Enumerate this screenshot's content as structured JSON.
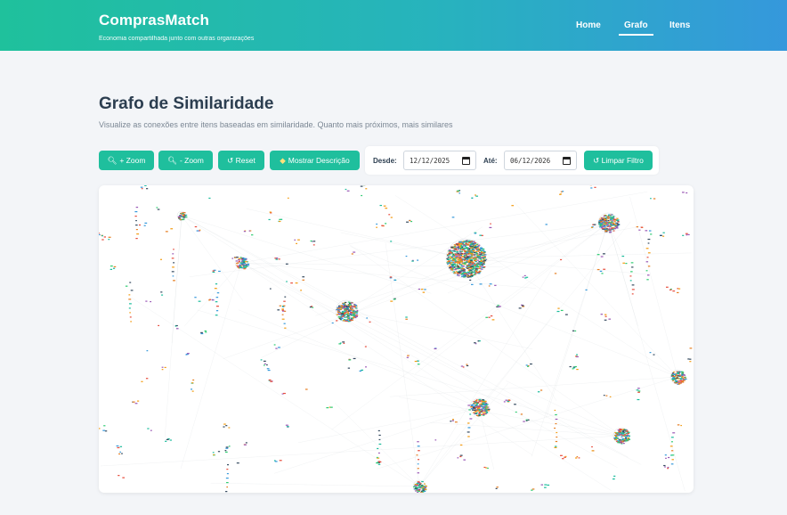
{
  "header": {
    "brand": "ComprasMatch",
    "tagline": "Economia compartilhada junto com outras organizações",
    "nav": [
      {
        "label": "Home",
        "active": false
      },
      {
        "label": "Grafo",
        "active": true
      },
      {
        "label": "Itens",
        "active": false
      }
    ]
  },
  "page": {
    "title": "Grafo de Similaridade",
    "subtitle": "Visualize as conexões entre itens baseadas em similaridade. Quanto mais próximos, mais similares"
  },
  "toolbar": {
    "zoom_in": "+ Zoom",
    "zoom_out": "- Zoom",
    "reset": "↺ Reset",
    "show_description": "Mostrar Descrição",
    "from_label": "Desde:",
    "from_value": "12/12/2025",
    "to_label": "Até:",
    "to_value": "06/12/2026",
    "clear_filter": "↺ Limpar Filtro"
  },
  "colors": {
    "accent": "#1fbf9d",
    "header_start": "#1fc19c",
    "header_end": "#3598dc",
    "node_palette": [
      "#2ecc71",
      "#e74c3c",
      "#3498db",
      "#f39c12",
      "#9b59b6",
      "#1abc9c",
      "#e67e22",
      "#34495e"
    ]
  }
}
